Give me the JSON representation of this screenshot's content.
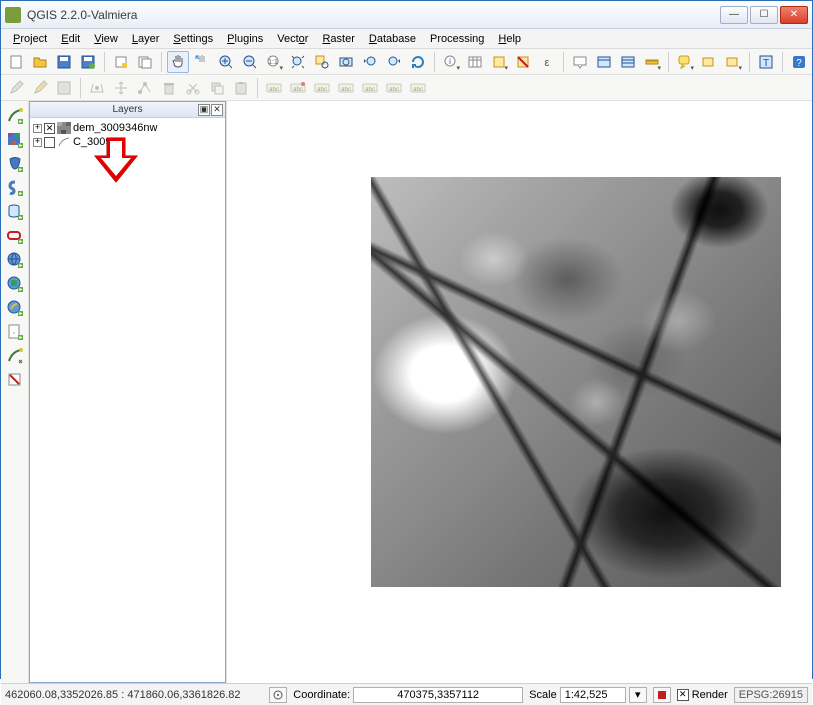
{
  "title": "QGIS 2.2.0-Valmiera",
  "menu": {
    "project": "Project",
    "edit": "Edit",
    "view": "View",
    "layer": "Layer",
    "settings": "Settings",
    "plugins": "Plugins",
    "vector": "Vector",
    "raster": "Raster",
    "database": "Database",
    "processing": "Processing",
    "help": "Help"
  },
  "panels": {
    "layers_title": "Layers"
  },
  "layers": [
    {
      "name": "dem_3009346nw",
      "checked": true,
      "type": "raster"
    },
    {
      "name": "C_3009",
      "checked": false,
      "type": "vector"
    }
  ],
  "status": {
    "extents": "462060.08,3352026.85 : 471860.06,3361826.82",
    "coord_label": "Coordinate:",
    "coord_value": "470375,3357112",
    "scale_label": "Scale",
    "scale_value": "1:42,525",
    "render_label": "Render",
    "epsg": "EPSG:26915"
  },
  "colors": {
    "accent": "#2a6fb5",
    "arrow": "#e30000"
  }
}
